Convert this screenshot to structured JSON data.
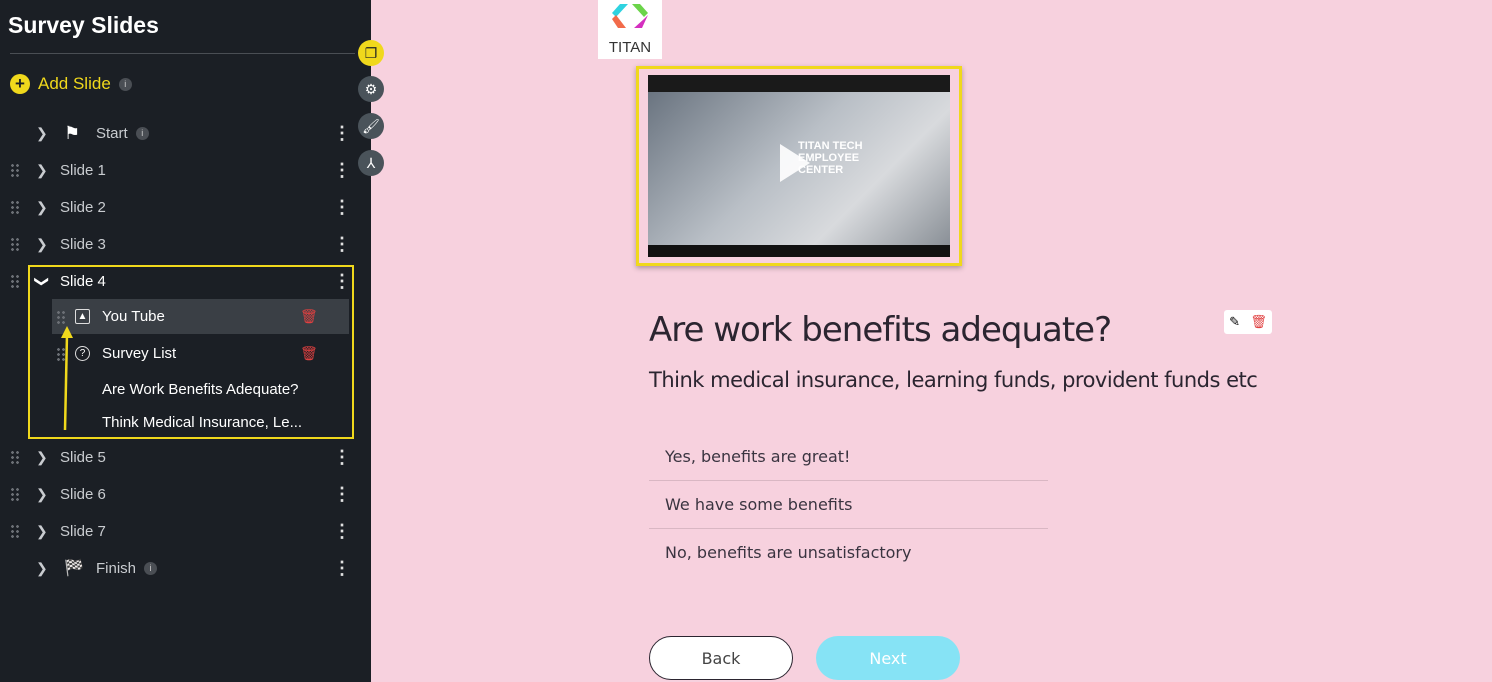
{
  "sidebar": {
    "title": "Survey Slides",
    "add_slide": "Add Slide",
    "info": "i",
    "start": "Start",
    "finish": "Finish",
    "slides": [
      "Slide 1",
      "Slide 2",
      "Slide 3",
      "Slide 4",
      "Slide 5",
      "Slide 6",
      "Slide 7"
    ],
    "children": [
      "You Tube",
      "Survey List",
      "Are Work Benefits Adequate?",
      "Think Medical Insurance, Le..."
    ]
  },
  "logo": {
    "text": "TITAN"
  },
  "video": {
    "overlay": "TITAN TECH EMPLOYEE CENTER"
  },
  "question": {
    "title": "Are work benefits adequate?",
    "subtitle": "Think medical insurance, learning funds, provident funds etc",
    "options": [
      "Yes, benefits are great!",
      "We have some benefits",
      "No, benefits are unsatisfactory"
    ]
  },
  "nav": {
    "back": "Back",
    "next": "Next"
  },
  "colors": {
    "accent": "#f0d81c",
    "sidebar": "#1b1f25",
    "background": "#f7d1de",
    "next": "#86e3f5"
  }
}
